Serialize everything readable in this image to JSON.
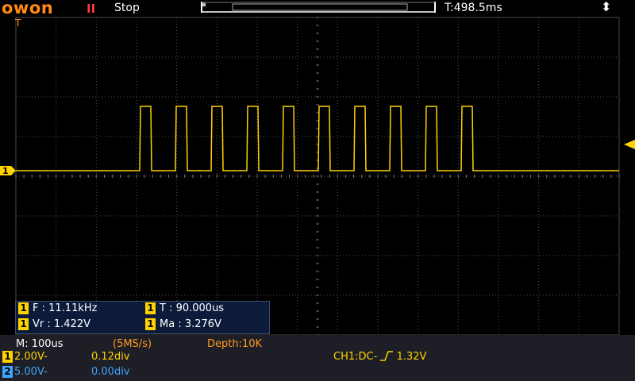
{
  "header": {
    "brand": "owon",
    "run_icon": "pause-icon",
    "run_status": "Stop",
    "trigger_time": "T:498.5ms",
    "usb_icon": "usb-icon"
  },
  "waveform": {
    "channel_marker": "1",
    "trigger_marker_icon": "trigger-level-arrow-icon",
    "top_marker": "T"
  },
  "measurements": [
    {
      "channel": "1",
      "label": "F : 11.11kHz"
    },
    {
      "channel": "1",
      "label": "T : 90.000us"
    },
    {
      "channel": "1",
      "label": "Vr : 1.422V"
    },
    {
      "channel": "1",
      "label": "Ma : 3.276V"
    }
  ],
  "timebase": {
    "main": "M: 100us",
    "sample_rate": "(5MS/s)",
    "depth": "Depth:10K"
  },
  "channels": [
    {
      "id": "1",
      "scale": "2.00V-",
      "offset": "0.12div"
    },
    {
      "id": "2",
      "scale": "5.00V-",
      "offset": "0.00div"
    }
  ],
  "trigger": {
    "label": "CH1:DC-",
    "edge_icon": "rising-edge-icon",
    "level": "1.32V"
  },
  "colors": {
    "brand": "#ff8a14",
    "ch1": "#ffd200",
    "ch2": "#3ea6ff",
    "timebase_text": "#ff9a1e",
    "panel_bg": "#1e1f26"
  }
}
